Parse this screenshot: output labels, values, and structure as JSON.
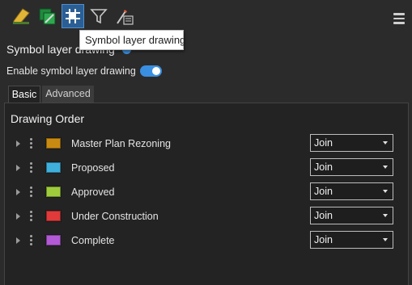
{
  "toolbar": {
    "buttons": [
      {
        "id": "symbology",
        "icon": "pencil-icon",
        "active": false
      },
      {
        "id": "layer-symbology",
        "icon": "layers-icon",
        "active": false
      },
      {
        "id": "symbol-layer-drawing",
        "icon": "grid-hash-icon",
        "active": true
      },
      {
        "id": "filter",
        "icon": "filter-icon",
        "active": false
      },
      {
        "id": "list-edit",
        "icon": "list-edit-icon",
        "active": false
      }
    ],
    "menu_icon": "hamburger-menu-icon"
  },
  "tooltip": {
    "text": "Symbol layer drawing"
  },
  "section": {
    "title": "Symbol layer drawing"
  },
  "enable": {
    "label": "Enable symbol layer drawing",
    "enabled": true
  },
  "tabs": [
    {
      "label": "Basic",
      "selected": true
    },
    {
      "label": "Advanced",
      "selected": false
    }
  ],
  "panel": {
    "title": "Drawing Order"
  },
  "layers": [
    {
      "name": "Master Plan Rezoning",
      "color": "#c98a12",
      "join": "Join"
    },
    {
      "name": "Proposed",
      "color": "#3fb0dc",
      "join": "Join"
    },
    {
      "name": "Approved",
      "color": "#9ecb3c",
      "join": "Join"
    },
    {
      "name": "Under Construction",
      "color": "#e03a3a",
      "join": "Join"
    },
    {
      "name": "Complete",
      "color": "#b259d6",
      "join": "Join"
    }
  ]
}
